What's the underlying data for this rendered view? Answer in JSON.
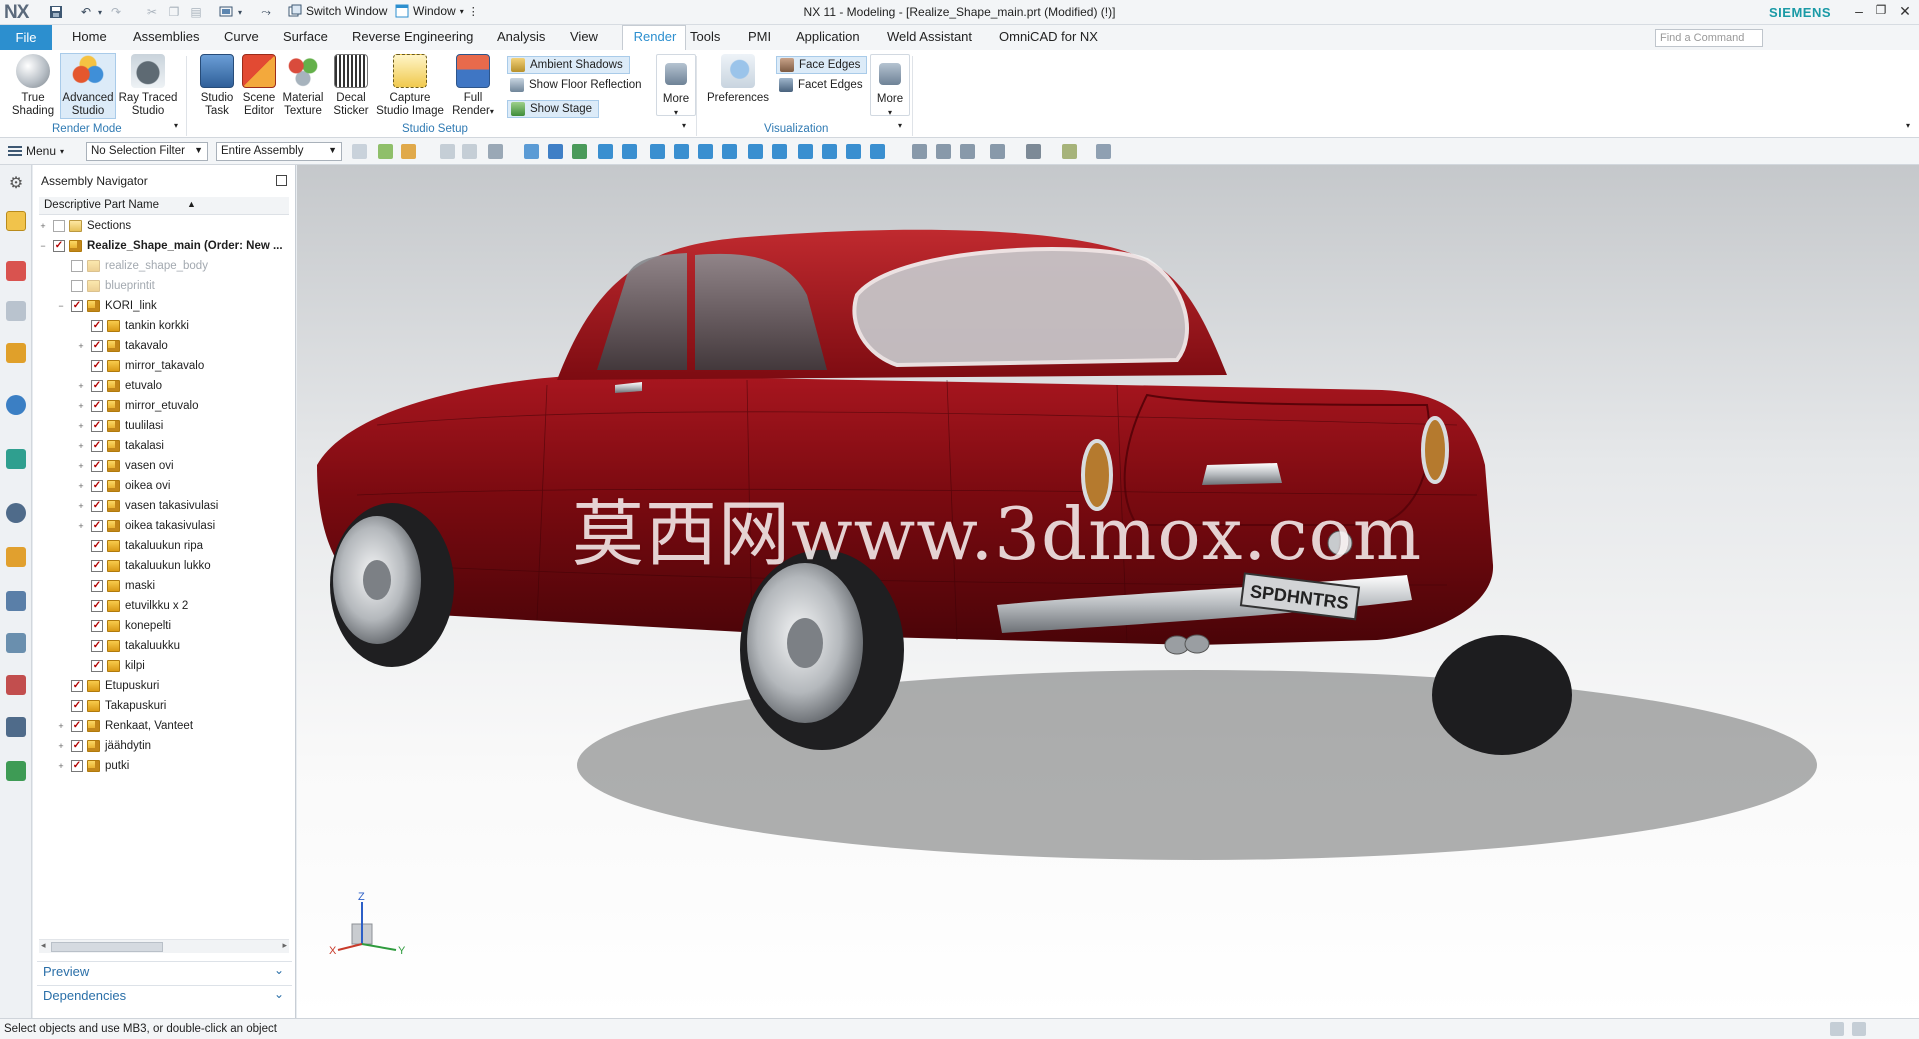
{
  "app": {
    "logo": "NX",
    "title": "NX 11 - Modeling - [Realize_Shape_main.prt (Modified)    (!)]",
    "brand": "SIEMENS",
    "switch_window": "Switch Window",
    "window_menu": "Window"
  },
  "menu_tabs": [
    "File",
    "Home",
    "Assemblies",
    "Curve",
    "Surface",
    "Reverse Engineering",
    "Analysis",
    "View",
    "Render",
    "Tools",
    "PMI",
    "Application",
    "Weld Assistant",
    "OmniCAD for NX"
  ],
  "active_tab": "Render",
  "find_command_placeholder": "Find a Command",
  "ribbon": {
    "render_mode": {
      "label": "Render Mode",
      "buttons": [
        "True Shading",
        "Advanced Studio",
        "Ray Traced Studio"
      ]
    },
    "studio_setup": {
      "label": "Studio Setup",
      "buttons": [
        "Studio Task",
        "Scene Editor",
        "Material Texture",
        "Decal Sticker",
        "Capture Studio Image",
        "Full Render"
      ],
      "small": [
        "Ambient Shadows",
        "Show Floor Reflection",
        "Show Stage"
      ],
      "more": "More"
    },
    "visualization": {
      "label": "Visualization",
      "preferences": "Preferences",
      "small": [
        "Face Edges",
        "Facet Edges"
      ],
      "more": "More"
    }
  },
  "selection_bar": {
    "menu": "Menu",
    "filter": "No Selection Filter",
    "scope": "Entire Assembly"
  },
  "navigator": {
    "title": "Assembly Navigator",
    "column": "Descriptive Part Name",
    "tree": [
      {
        "label": "Sections",
        "level": 0,
        "expander": "+",
        "checked": false,
        "icon": "folder",
        "style": ""
      },
      {
        "label": "Realize_Shape_main (Order: New ...",
        "level": 0,
        "expander": "−",
        "checked": true,
        "icon": "asm",
        "style": "bold"
      },
      {
        "label": "realize_shape_body",
        "level": 1,
        "expander": "",
        "checked": false,
        "icon": "part",
        "style": "dim"
      },
      {
        "label": "blueprintit",
        "level": 1,
        "expander": "",
        "checked": false,
        "icon": "part",
        "style": "dim"
      },
      {
        "label": "KORI_link",
        "level": 1,
        "expander": "−",
        "checked": true,
        "icon": "asm",
        "style": ""
      },
      {
        "label": "tankin korkki",
        "level": 2,
        "expander": "",
        "checked": true,
        "icon": "part",
        "style": ""
      },
      {
        "label": "takavalo",
        "level": 2,
        "expander": "+",
        "checked": true,
        "icon": "asm",
        "style": ""
      },
      {
        "label": "mirror_takavalo",
        "level": 2,
        "expander": "",
        "checked": true,
        "icon": "part",
        "style": ""
      },
      {
        "label": "etuvalo",
        "level": 2,
        "expander": "+",
        "checked": true,
        "icon": "asm",
        "style": ""
      },
      {
        "label": "mirror_etuvalo",
        "level": 2,
        "expander": "+",
        "checked": true,
        "icon": "asm",
        "style": ""
      },
      {
        "label": "tuulilasi",
        "level": 2,
        "expander": "+",
        "checked": true,
        "icon": "asm",
        "style": ""
      },
      {
        "label": "takalasi",
        "level": 2,
        "expander": "+",
        "checked": true,
        "icon": "asm",
        "style": ""
      },
      {
        "label": "vasen ovi",
        "level": 2,
        "expander": "+",
        "checked": true,
        "icon": "asm",
        "style": ""
      },
      {
        "label": "oikea ovi",
        "level": 2,
        "expander": "+",
        "checked": true,
        "icon": "asm",
        "style": ""
      },
      {
        "label": "vasen takasivulasi",
        "level": 2,
        "expander": "+",
        "checked": true,
        "icon": "asm",
        "style": ""
      },
      {
        "label": "oikea takasivulasi",
        "level": 2,
        "expander": "+",
        "checked": true,
        "icon": "asm",
        "style": ""
      },
      {
        "label": "takaluukun ripa",
        "level": 2,
        "expander": "",
        "checked": true,
        "icon": "part",
        "style": ""
      },
      {
        "label": "takaluukun lukko",
        "level": 2,
        "expander": "",
        "checked": true,
        "icon": "part",
        "style": ""
      },
      {
        "label": "maski",
        "level": 2,
        "expander": "",
        "checked": true,
        "icon": "part",
        "style": ""
      },
      {
        "label": "etuvilkku x 2",
        "level": 2,
        "expander": "",
        "checked": true,
        "icon": "part",
        "style": ""
      },
      {
        "label": "konepelti",
        "level": 2,
        "expander": "",
        "checked": true,
        "icon": "part",
        "style": ""
      },
      {
        "label": "takaluukku",
        "level": 2,
        "expander": "",
        "checked": true,
        "icon": "part",
        "style": ""
      },
      {
        "label": "kilpi",
        "level": 2,
        "expander": "",
        "checked": true,
        "icon": "part",
        "style": ""
      },
      {
        "label": "Etupuskuri",
        "level": 1,
        "expander": "",
        "checked": true,
        "icon": "part",
        "style": ""
      },
      {
        "label": "Takapuskuri",
        "level": 1,
        "expander": "",
        "checked": true,
        "icon": "part",
        "style": ""
      },
      {
        "label": "Renkaat, Vanteet",
        "level": 1,
        "expander": "+",
        "checked": true,
        "icon": "asm",
        "style": ""
      },
      {
        "label": "jäähdytin",
        "level": 1,
        "expander": "+",
        "checked": true,
        "icon": "asm",
        "style": ""
      },
      {
        "label": "putki",
        "level": 1,
        "expander": "+",
        "checked": true,
        "icon": "asm",
        "style": ""
      }
    ],
    "panels": [
      "Preview",
      "Dependencies"
    ]
  },
  "viewport": {
    "watermark": "莫西网www.3dmox.com",
    "license_plate": "SPDHNTRS",
    "triad": {
      "x": "X",
      "y": "Y",
      "z": "Z"
    },
    "car_color": "#7a0a10"
  },
  "status": "Select objects and use MB3, or double-click an object",
  "colors": {
    "accent": "#2c8fcf",
    "group_label": "#2f7ab3",
    "brand": "#1a9aa6"
  }
}
